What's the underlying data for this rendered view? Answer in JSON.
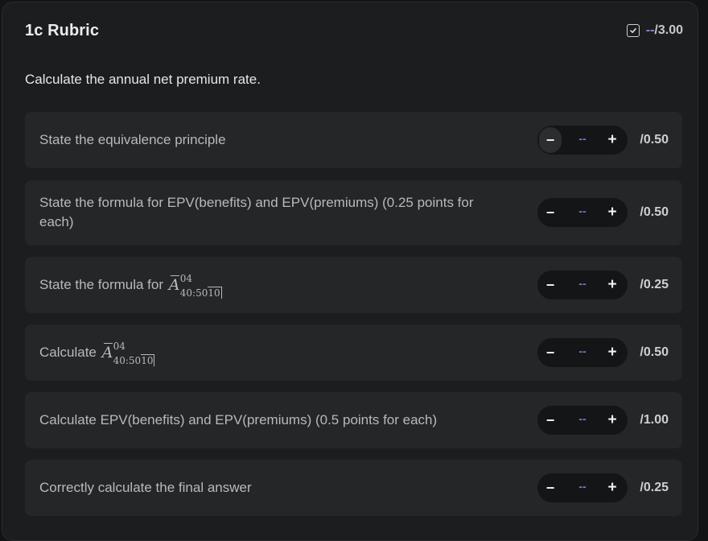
{
  "header": {
    "title": "1c Rubric",
    "score_value": "--",
    "score_max": "/3.00"
  },
  "prompt": "Calculate the annual net premium rate.",
  "math": {
    "symbol": "A",
    "superscript": "04",
    "subscript_status": "40:50",
    "subscript_term": "10"
  },
  "rows": [
    {
      "label": "State the equivalence principle",
      "value": "--",
      "max": "/0.50"
    },
    {
      "label": "State the formula for EPV(benefits) and EPV(premiums) (0.25 points for each)",
      "value": "--",
      "max": "/0.50"
    },
    {
      "label": "State the formula for",
      "value": "--",
      "max": "/0.25"
    },
    {
      "label": "Calculate",
      "value": "--",
      "max": "/0.50"
    },
    {
      "label": "Calculate EPV(benefits) and EPV(premiums) (0.5 points for each)",
      "value": "--",
      "max": "/1.00"
    },
    {
      "label": "Correctly calculate the final answer",
      "value": "--",
      "max": "/0.25"
    }
  ],
  "stepper": {
    "decrement_symbol": "−",
    "increment_symbol": "+"
  },
  "colors": {
    "accent_value": "#8f86e0",
    "panel_bg": "#1c1d1e",
    "row_bg": "#252627"
  }
}
